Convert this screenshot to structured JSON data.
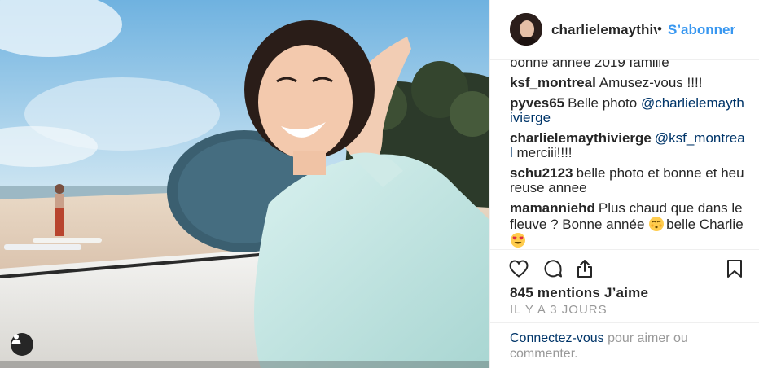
{
  "post": {
    "username": "charlielemaythivierge",
    "separator": "•",
    "follow_label": "S’abonner"
  },
  "comments": [
    {
      "user": "",
      "text": "bonne année 2019 famille"
    },
    {
      "user": "ksf_montreal",
      "text": "Amusez-vous !!!!"
    },
    {
      "user": "pyves65",
      "text": "Belle photo",
      "mention": "@charlielemaythivierge"
    },
    {
      "user": "charlielemaythivierge",
      "mention": "@ksf_montreal",
      "text": "merciii!!!!"
    },
    {
      "user": "schu2123",
      "text": "belle photo et bonne et heureuse annee"
    },
    {
      "user": "mamanniehd",
      "text": "Plus chaud que dans le fleuve ? Bonne année",
      "text2": "belle Charlie",
      "emoji1": "kissing-face-icon",
      "emoji2": "heart-eyes-icon"
    }
  ],
  "likes_text": "845 mentions J’aime",
  "time_text": "IL Y A 3 JOURS",
  "login": {
    "link_label": "Connectez-vous",
    "rest": "pour aimer ou commenter."
  },
  "icons": {
    "like": "heart-outline-icon",
    "comment": "comment-bubble-icon",
    "share": "share-upload-icon",
    "save": "bookmark-icon",
    "tag": "user-tag-icon"
  },
  "colors": {
    "accent": "#3897f0",
    "link": "#003569",
    "muted": "#999999",
    "text": "#262626"
  }
}
